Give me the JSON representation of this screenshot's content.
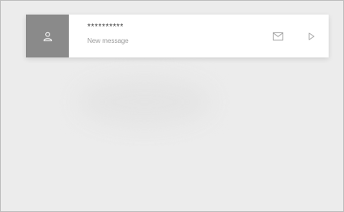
{
  "notification": {
    "sender": "**********",
    "message": "New message",
    "avatar_icon": "person-icon",
    "actions": [
      {
        "icon": "envelope-icon"
      },
      {
        "icon": "play-icon"
      }
    ]
  },
  "colors": {
    "background": "#ececec",
    "card": "#ffffff",
    "avatar_bg": "#8a8a8a",
    "icon": "#a8a8a8"
  }
}
